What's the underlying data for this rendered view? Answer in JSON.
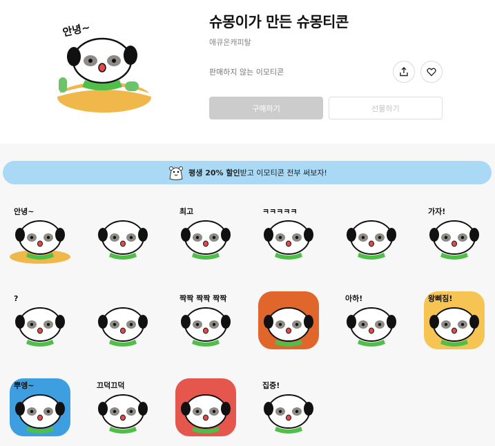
{
  "product": {
    "title": "슈몽이가 만든 슈몽티콘",
    "author": "애큐온캐피탈",
    "availability": "판매하지 않는 이모티콘",
    "hero_caption": "안녕~"
  },
  "actions": {
    "share_icon": "share-icon",
    "like_icon": "heart-icon",
    "buy_label": "구매하기",
    "gift_label": "선물하기"
  },
  "promo": {
    "highlight": "평생 20% 할인",
    "rest": " 받고 이모티콘 전부 써보자!"
  },
  "colors": {
    "banner_bg": "#a9d9f5",
    "buy_bg": "#cccccc",
    "scarf_green": "#4fbf4a",
    "sand": "#f0b84a"
  },
  "stickers": [
    {
      "caption": "안녕~"
    },
    {
      "caption": ""
    },
    {
      "caption": "최고"
    },
    {
      "caption": "ㅋㅋㅋㅋㅋ"
    },
    {
      "caption": ""
    },
    {
      "caption": "가자!"
    },
    {
      "caption": "?"
    },
    {
      "caption": ""
    },
    {
      "caption": "짝짝 짝짝 짝짝"
    },
    {
      "caption": ""
    },
    {
      "caption": "아하!"
    },
    {
      "caption": "왕삐짐!"
    },
    {
      "caption": "뿌엥~"
    },
    {
      "caption": "끄덕끄덕"
    },
    {
      "caption": ""
    },
    {
      "caption": "집중!"
    }
  ]
}
